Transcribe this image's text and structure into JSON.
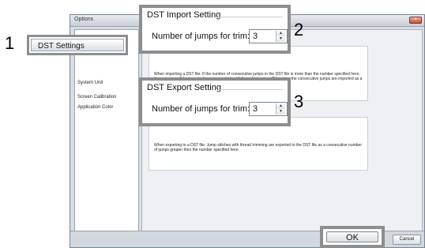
{
  "window": {
    "title": "Options",
    "close_glyph": "×"
  },
  "sidebar": {
    "items": [
      {
        "label": "DST Settings"
      },
      {
        "label": "System Unit"
      },
      {
        "label": "Screen Calibration"
      },
      {
        "label": "Application Color"
      }
    ]
  },
  "dst_import": {
    "title": "DST Import Setting",
    "field_label": "Number of jumps for trim:",
    "value": "3",
    "description": "When importing a DST file: If the number of consecutive jumps in the DST file is more than the number specified here, those jumps will be imported as a jump stitch with thread trimming. Otherwise, the consecutive jumps are imported as a stitch."
  },
  "dst_export": {
    "title": "DST Export Setting",
    "field_label": "Number of jumps for trim:",
    "value": "3",
    "description": "When exporting to a DST file: Jump stitches with thread trimming are exported to the DST file as a consecutive number of jumps greater then the number specified here."
  },
  "buttons": {
    "ok": "OK",
    "cancel": "Cancel"
  },
  "callout_numbers": {
    "one": "1",
    "two": "2",
    "three": "3"
  },
  "icons": {
    "spin_up": "up-arrow-icon",
    "spin_down": "down-arrow-icon",
    "close": "close-icon"
  }
}
